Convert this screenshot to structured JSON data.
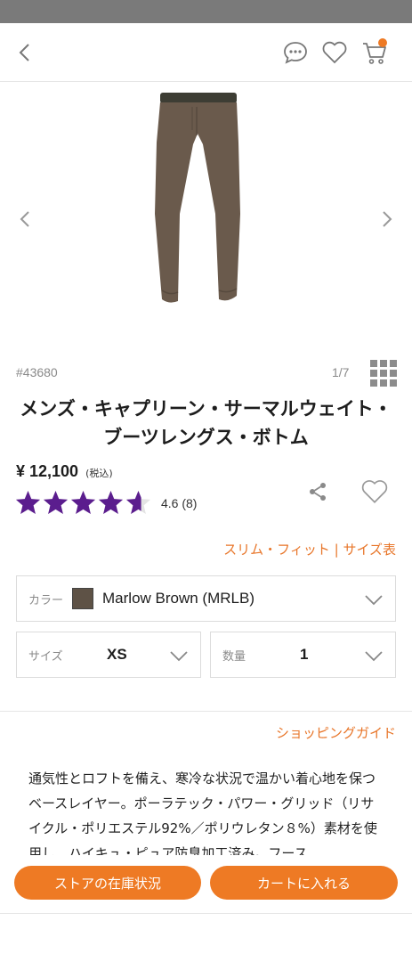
{
  "header": {
    "back_icon": "chevron-left-icon",
    "icons": [
      "chat-bubble-icon",
      "heart-icon",
      "cart-icon"
    ],
    "cart_badge_color": "#ee7a24"
  },
  "gallery": {
    "image_alt": "Marlow Brown base layer bottoms",
    "counter": "1/7",
    "prev_icon": "chevron-left-icon",
    "next_icon": "chevron-right-icon"
  },
  "product": {
    "sku": "#43680",
    "title": "メンズ・キャプリーン・サーマルウェイト・ブーツレングス・ボトム",
    "price": "¥ 12,100",
    "tax_note": "(税込)",
    "rating_value": 4.6,
    "rating_text": "4.6 (8)",
    "star_color": "#5b1d8e"
  },
  "fit": {
    "fit_label": "スリム・フィット",
    "separator": " | ",
    "size_chart_label": "サイズ表"
  },
  "options": {
    "color_label": "カラー",
    "color_value": "Marlow Brown (MRLB)",
    "color_swatch": "#5e5246",
    "size_label": "サイズ",
    "size_value": "XS",
    "qty_label": "数量",
    "qty_value": "1"
  },
  "guide": {
    "label": "ショッピングガイド"
  },
  "description": {
    "text": "通気性とロフトを備え、寒冷な状況で温かい着心地を保つベースレイヤー。ポーラテック・パワー・グリッド（リサイクル・ポリエステル92%／ポリウレタン８%）素材を使用し、ハイキュ・ピュア防臭加工済み。フース"
  },
  "actions": {
    "store_stock": "ストアの在庫状況",
    "add_to_cart": "カートに入れる"
  },
  "colors": {
    "accent": "#ee7a24",
    "link": "#e8762a"
  }
}
